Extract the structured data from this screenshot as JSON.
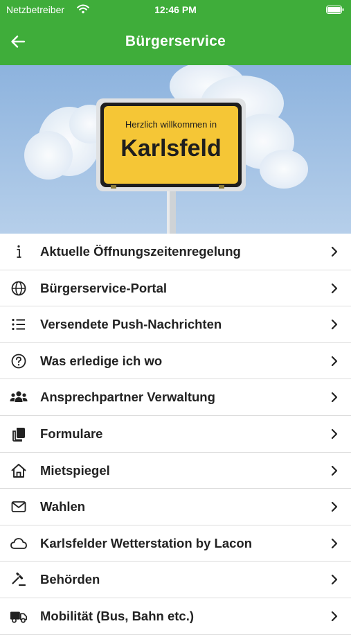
{
  "status_bar": {
    "carrier": "Netzbetreiber",
    "time": "12:46 PM",
    "icons": [
      "wifi-icon",
      "battery-icon"
    ]
  },
  "nav": {
    "title": "Bürgerservice",
    "back_icon": "arrow-left-icon"
  },
  "hero": {
    "sign_line1": "Herzlich willkommen in",
    "sign_line2": "Karlsfeld"
  },
  "colors": {
    "header_green": "#3fad3a",
    "sign_yellow": "#f5c636"
  },
  "menu": [
    {
      "label": "Aktuelle Öffnungszeitenregelung",
      "icon": "info-icon"
    },
    {
      "label": "Bürgerservice-Portal",
      "icon": "globe-icon"
    },
    {
      "label": "Versendete Push-Nachrichten",
      "icon": "list-icon"
    },
    {
      "label": "Was erledige ich wo",
      "icon": "question-circle-icon"
    },
    {
      "label": "Ansprechpartner Verwaltung",
      "icon": "users-icon"
    },
    {
      "label": "Formulare",
      "icon": "documents-icon"
    },
    {
      "label": "Mietspiegel",
      "icon": "house-icon"
    },
    {
      "label": "Wahlen",
      "icon": "envelope-icon"
    },
    {
      "label": "Karlsfelder Wetterstation by Lacon",
      "icon": "cloud-icon"
    },
    {
      "label": "Behörden",
      "icon": "gavel-icon"
    },
    {
      "label": "Mobilität (Bus, Bahn etc.)",
      "icon": "truck-icon"
    }
  ]
}
